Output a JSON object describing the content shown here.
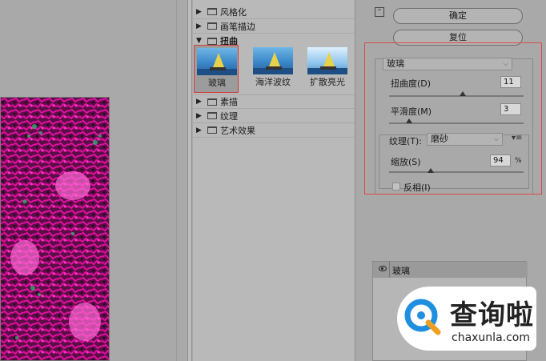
{
  "filter_list": {
    "categories": [
      {
        "label": "风格化",
        "expanded": false
      },
      {
        "label": "画笔描边",
        "expanded": false
      },
      {
        "label": "扭曲",
        "expanded": true
      },
      {
        "label": "素描",
        "expanded": false
      },
      {
        "label": "纹理",
        "expanded": false
      },
      {
        "label": "艺术效果",
        "expanded": false
      }
    ],
    "distort_filters": [
      {
        "label": "玻璃",
        "selected": true
      },
      {
        "label": "海洋波纹",
        "selected": false
      },
      {
        "label": "扩散亮光",
        "selected": false
      }
    ]
  },
  "settings": {
    "ok_label": "确定",
    "reset_label": "复位",
    "filter_select": "玻璃",
    "distortion_label": "扭曲度(D)",
    "distortion_value": "11",
    "distortion_fraction": 0.55,
    "smoothness_label": "平滑度(M)",
    "smoothness_value": "3",
    "smoothness_fraction": 0.15,
    "texture_label": "纹理(T):",
    "texture_value": "磨砂",
    "scaling_label": "缩放(S)",
    "scaling_value": "94",
    "scaling_unit": "%",
    "scaling_fraction": 0.31,
    "invert_label": "反相(I)",
    "invert_checked": false
  },
  "layers": {
    "items": [
      {
        "label": "玻璃",
        "visible": true
      }
    ]
  },
  "watermark": {
    "name": "查询啦",
    "url": "chaxunla.com"
  }
}
